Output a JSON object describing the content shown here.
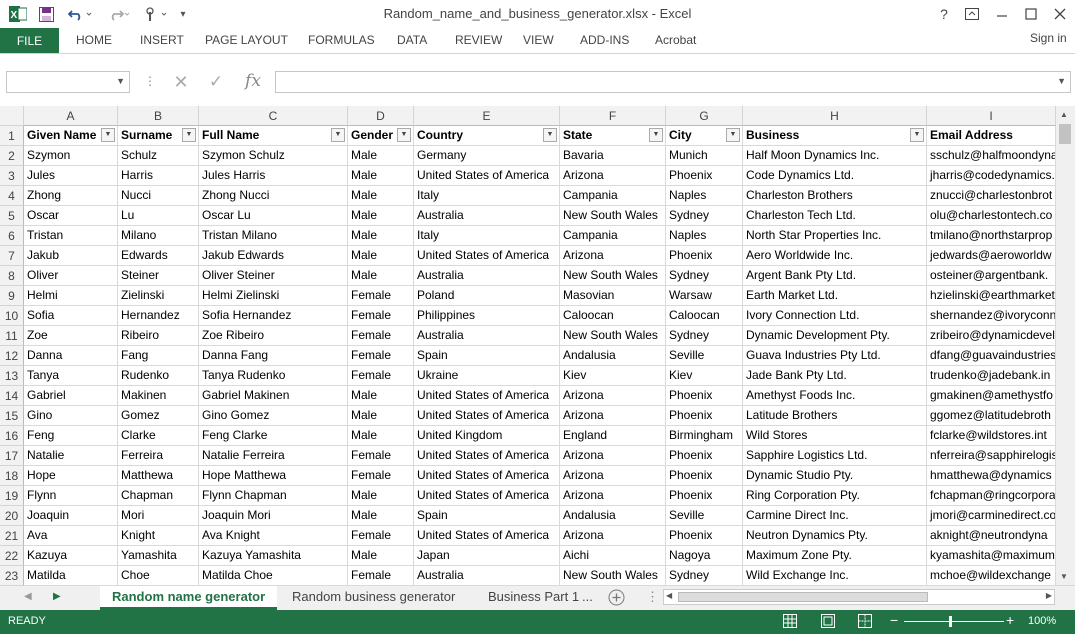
{
  "app": {
    "title": "Random_name_and_business_generator.xlsx - Excel",
    "help": "?",
    "sign_in": "Sign in"
  },
  "ribbon": {
    "file": "FILE",
    "tabs": [
      "HOME",
      "INSERT",
      "PAGE LAYOUT",
      "FORMULAS",
      "DATA",
      "REVIEW",
      "VIEW",
      "ADD-INS",
      "Acrobat"
    ]
  },
  "formula_bar": {
    "name_box": "",
    "fx": "fx",
    "content": ""
  },
  "columns": [
    "A",
    "B",
    "C",
    "D",
    "E",
    "F",
    "G",
    "H",
    "I"
  ],
  "header_row": [
    "Given Name",
    "Surname",
    "Full Name",
    "Gender",
    "Country",
    "State",
    "City",
    "Business",
    "Email Address"
  ],
  "rows": [
    [
      "Szymon",
      "Schulz",
      "Szymon Schulz",
      "Male",
      "Germany",
      "Bavaria",
      "Munich",
      "Half Moon Dynamics Inc.",
      "sschulz@halfmoondyna"
    ],
    [
      "Jules",
      "Harris",
      "Jules Harris",
      "Male",
      "United States of America",
      "Arizona",
      "Phoenix",
      "Code Dynamics Ltd.",
      "jharris@codedynamics."
    ],
    [
      "Zhong",
      "Nucci",
      "Zhong Nucci",
      "Male",
      "Italy",
      "Campania",
      "Naples",
      "Charleston Brothers",
      "znucci@charlestonbrot"
    ],
    [
      "Oscar",
      "Lu",
      "Oscar Lu",
      "Male",
      "Australia",
      "New South Wales",
      "Sydney",
      "Charleston Tech Ltd.",
      "olu@charlestontech.co"
    ],
    [
      "Tristan",
      "Milano",
      "Tristan Milano",
      "Male",
      "Italy",
      "Campania",
      "Naples",
      "North Star Properties Inc.",
      "tmilano@northstarprop"
    ],
    [
      "Jakub",
      "Edwards",
      "Jakub Edwards",
      "Male",
      "United States of America",
      "Arizona",
      "Phoenix",
      "Aero Worldwide Inc.",
      "jedwards@aeroworldw"
    ],
    [
      "Oliver",
      "Steiner",
      "Oliver Steiner",
      "Male",
      "Australia",
      "New South Wales",
      "Sydney",
      "Argent Bank Pty Ltd.",
      "osteiner@argentbank."
    ],
    [
      "Helmi",
      "Zielinski",
      "Helmi Zielinski",
      "Female",
      "Poland",
      "Masovian",
      "Warsaw",
      "Earth Market Ltd.",
      "hzielinski@earthmarket"
    ],
    [
      "Sofia",
      "Hernandez",
      "Sofia Hernandez",
      "Female",
      "Philippines",
      "Caloocan",
      "Caloocan",
      "Ivory Connection Ltd.",
      "shernandez@ivoryconn"
    ],
    [
      "Zoe",
      "Ribeiro",
      "Zoe Ribeiro",
      "Female",
      "Australia",
      "New South Wales",
      "Sydney",
      "Dynamic Development Pty.",
      "zribeiro@dynamicdevel"
    ],
    [
      "Danna",
      "Fang",
      "Danna Fang",
      "Female",
      "Spain",
      "Andalusia",
      "Seville",
      "Guava Industries Pty Ltd.",
      "dfang@guavaindustries"
    ],
    [
      "Tanya",
      "Rudenko",
      "Tanya Rudenko",
      "Female",
      "Ukraine",
      "Kiev",
      "Kiev",
      "Jade Bank Pty Ltd.",
      "trudenko@jadebank.in"
    ],
    [
      "Gabriel",
      "Makinen",
      "Gabriel Makinen",
      "Male",
      "United States of America",
      "Arizona",
      "Phoenix",
      "Amethyst Foods Inc.",
      "gmakinen@amethystfo"
    ],
    [
      "Gino",
      "Gomez",
      "Gino Gomez",
      "Male",
      "United States of America",
      "Arizona",
      "Phoenix",
      "Latitude Brothers",
      "ggomez@latitudebroth"
    ],
    [
      "Feng",
      "Clarke",
      "Feng Clarke",
      "Male",
      "United Kingdom",
      "England",
      "Birmingham",
      "Wild Stores",
      "fclarke@wildstores.int"
    ],
    [
      "Natalie",
      "Ferreira",
      "Natalie Ferreira",
      "Female",
      "United States of America",
      "Arizona",
      "Phoenix",
      "Sapphire Logistics Ltd.",
      "nferreira@sapphirelogis"
    ],
    [
      "Hope",
      "Matthewa",
      "Hope Matthewa",
      "Female",
      "United States of America",
      "Arizona",
      "Phoenix",
      "Dynamic Studio Pty.",
      "hmatthewa@dynamics"
    ],
    [
      "Flynn",
      "Chapman",
      "Flynn Chapman",
      "Male",
      "United States of America",
      "Arizona",
      "Phoenix",
      "Ring Corporation Pty.",
      "fchapman@ringcorpora"
    ],
    [
      "Joaquin",
      "Mori",
      "Joaquin Mori",
      "Male",
      "Spain",
      "Andalusia",
      "Seville",
      "Carmine Direct Inc.",
      "jmori@carminedirect.co"
    ],
    [
      "Ava",
      "Knight",
      "Ava Knight",
      "Female",
      "United States of America",
      "Arizona",
      "Phoenix",
      "Neutron Dynamics Pty.",
      "aknight@neutrondyna"
    ],
    [
      "Kazuya",
      "Yamashita",
      "Kazuya Yamashita",
      "Male",
      "Japan",
      "Aichi",
      "Nagoya",
      "Maximum Zone Pty.",
      "kyamashita@maximum"
    ],
    [
      "Matilda",
      "Choe",
      "Matilda Choe",
      "Female",
      "Australia",
      "New South Wales",
      "Sydney",
      "Wild Exchange Inc.",
      "mchoe@wildexchange"
    ]
  ],
  "sheets": {
    "active": "Random name generator",
    "second": "Random business generator",
    "third": "Business Part 1",
    "more": "..."
  },
  "status": {
    "text": "READY",
    "zoom": "100%"
  },
  "colors": {
    "excel_green": "#217346"
  }
}
